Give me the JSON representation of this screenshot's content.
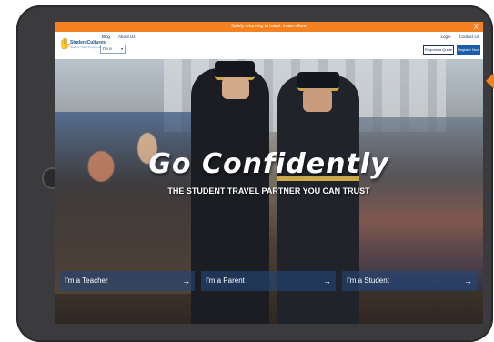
{
  "banner": {
    "text": "Safely returning to travel. Learn More",
    "close": "X"
  },
  "header": {
    "logo": {
      "name": "StudentCultures",
      "tag": "Student Travel Programs"
    },
    "nav": [
      "Blog",
      "About Us"
    ],
    "select_value": "I'm a",
    "select_caret": "▾",
    "top_links": [
      "Login",
      "Contact Us"
    ],
    "quote_button": "Request a Quote",
    "register_button": "Register Now"
  },
  "hero": {
    "title": "Go Confidently",
    "subtitle": "THE STUDENT TRAVEL PARTNER YOU CAN TRUST",
    "ctas": [
      {
        "label": "I'm a Teacher",
        "arrow": "→"
      },
      {
        "label": "I'm a Parent",
        "arrow": "→"
      },
      {
        "label": "I'm a Student",
        "arrow": "→"
      }
    ]
  },
  "colors": {
    "accent": "#f58220",
    "brand": "#1a5dad",
    "cta_bg": "#23467899"
  }
}
